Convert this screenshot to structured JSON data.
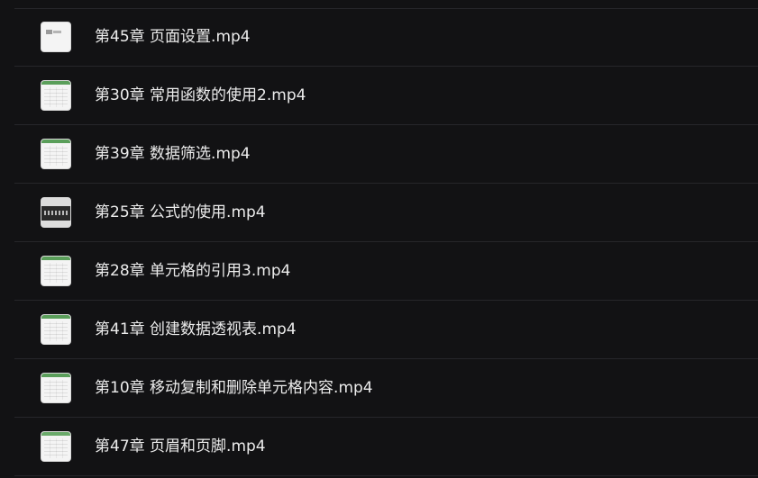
{
  "file_list": {
    "items": [
      {
        "name": "第45章 页面设置.mp4",
        "thumb": "plain",
        "accent": "#cfcfcf"
      },
      {
        "name": "第30章 常用函数的使用2.mp4",
        "thumb": "sheet",
        "accent": "#5a9e5a"
      },
      {
        "name": "第39章 数据筛选.mp4",
        "thumb": "sheet",
        "accent": "#5a9e5a"
      },
      {
        "name": "第25章 公式的使用.mp4",
        "thumb": "dark",
        "accent": "#2a2a2a"
      },
      {
        "name": "第28章 单元格的引用3.mp4",
        "thumb": "sheet",
        "accent": "#5a9e5a"
      },
      {
        "name": "第41章 创建数据透视表.mp4",
        "thumb": "sheet",
        "accent": "#5a9e5a"
      },
      {
        "name": "第10章 移动复制和删除单元格内容.mp4",
        "thumb": "sheet",
        "accent": "#5a9e5a"
      },
      {
        "name": "第47章 页眉和页脚.mp4",
        "thumb": "sheet",
        "accent": "#6aaa6a"
      }
    ]
  }
}
